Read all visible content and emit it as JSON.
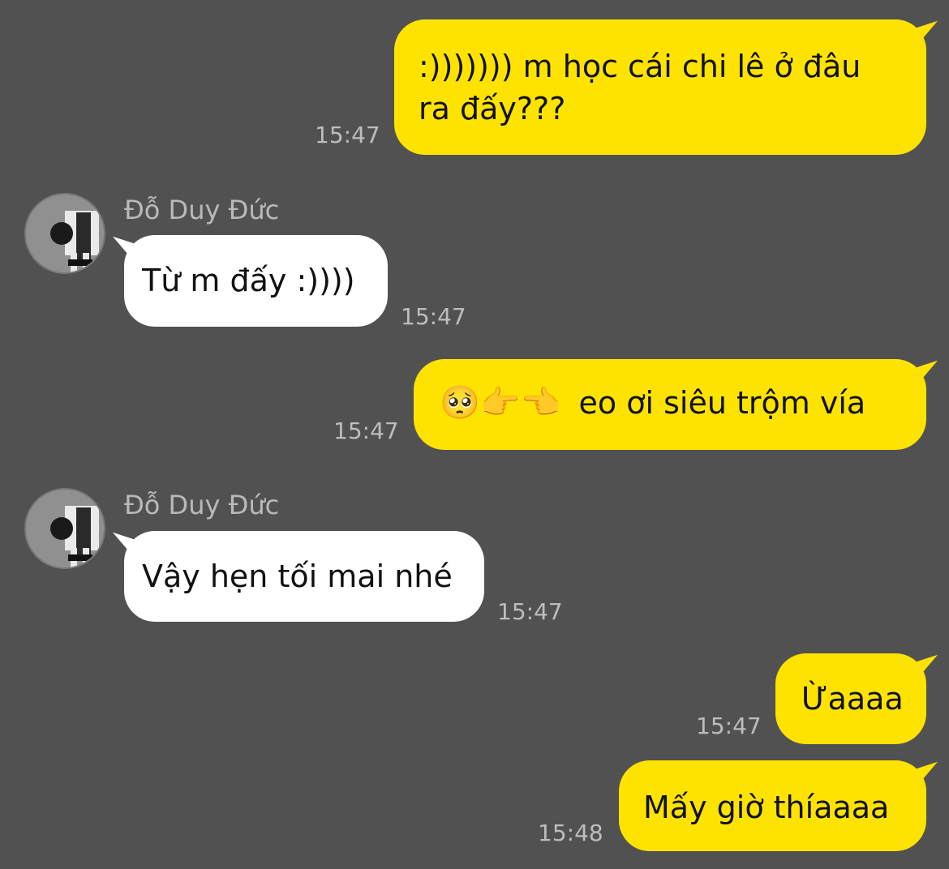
{
  "contact": {
    "name": "Đỗ Duy Đức"
  },
  "messages": [
    {
      "direction": "out",
      "lines": [
        ":))))))) m học cái chi lê ở đâu",
        "ra đấy???"
      ],
      "time": "15:47"
    },
    {
      "direction": "in",
      "sender": "Đỗ Duy Đức",
      "text": "Từ m đấy :))))",
      "time": "15:47"
    },
    {
      "direction": "out",
      "emojis": "🥺👉👈",
      "text": "eo ơi siêu trộm vía",
      "time": "15:47"
    },
    {
      "direction": "in",
      "sender": "Đỗ Duy Đức",
      "text": "Vậy hẹn tối mai nhé",
      "time": "15:47"
    },
    {
      "direction": "out",
      "text": "Ừaaaa",
      "time": "15:47"
    },
    {
      "direction": "out",
      "text": "Mấy giờ thíaaaa",
      "time": "15:48"
    }
  ],
  "colors": {
    "background": "#525152",
    "outgoing_bubble": "#ffe300",
    "incoming_bubble": "#ffffff",
    "timestamp": "#bdbdbd",
    "sender_name": "#b9b9b9"
  }
}
